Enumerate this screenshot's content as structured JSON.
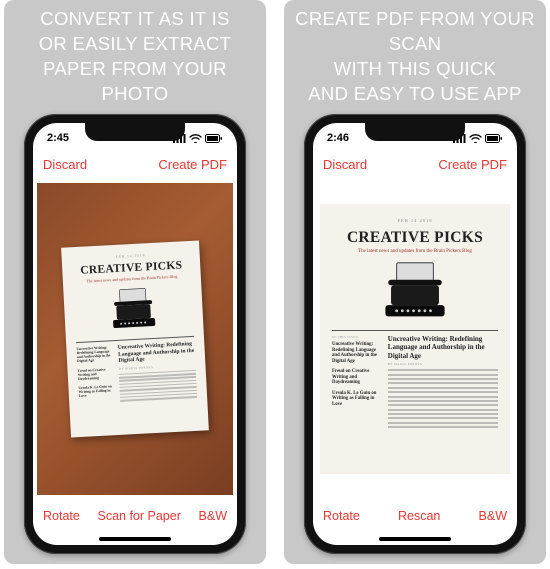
{
  "accent": "#e53935",
  "promos": [
    "CONVERT IT AS IT IS\nOR EASILY EXTRACT\nPAPER FROM YOUR PHOTO",
    "CREATE PDF FROM YOUR SCAN\nWITH THIS QUICK\nAND EASY TO USE APP"
  ],
  "screens": [
    {
      "time": "2:45",
      "nav": {
        "left": "Discard",
        "right": "Create PDF"
      },
      "toolbar": {
        "left": "Rotate",
        "center": "Scan for Paper",
        "right": "B&W"
      }
    },
    {
      "time": "2:46",
      "nav": {
        "left": "Discard",
        "right": "Create PDF"
      },
      "toolbar": {
        "left": "Rotate",
        "center": "Rescan",
        "right": "B&W"
      }
    }
  ],
  "doc": {
    "date": "FEB 14 2018",
    "title": "CREATIVE PICKS",
    "subtitle": "The latest news and updates from the Brain Pickers Blog",
    "headline": "Uncreative Writing:\nRedefining Language and\nAuthorship in the Digital Age",
    "byline": "BY MARIA POPOVA",
    "sidebar": [
      "Uncreative Writing: Redefining Language and Authorship in the Digital Age",
      "Freud on Creative Writing and Daydreaming",
      "Ursula K. Le Guin on Writing as Falling in Love"
    ],
    "sidebar_label": "IN THIS ISSUE"
  }
}
